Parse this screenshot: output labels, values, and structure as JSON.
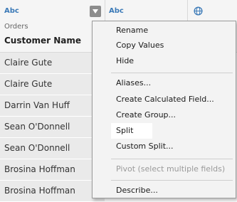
{
  "columns": [
    {
      "type_label": "Abc",
      "source": "Orders",
      "name": "Customer Name"
    },
    {
      "type_label": "Abc"
    },
    {
      "type_icon": "globe-icon"
    }
  ],
  "rows": [
    "Claire Gute",
    "Claire Gute",
    "Darrin Van Huff",
    "Sean O'Donnell",
    "Sean O'Donnell",
    "Brosina Hoffman",
    "Brosina Hoffman"
  ],
  "context_menu": {
    "items": [
      {
        "label": "Rename",
        "enabled": true
      },
      {
        "label": "Copy Values",
        "enabled": true
      },
      {
        "label": "Hide",
        "enabled": true
      },
      {
        "label": "Aliases...",
        "enabled": true
      },
      {
        "label": "Create Calculated Field...",
        "enabled": true
      },
      {
        "label": "Create Group...",
        "enabled": true
      },
      {
        "label": "Split",
        "enabled": true,
        "highlighted": true
      },
      {
        "label": "Custom Split...",
        "enabled": true
      },
      {
        "label": "Pivot (select multiple fields)",
        "enabled": false
      },
      {
        "label": "Describe...",
        "enabled": true
      }
    ]
  },
  "colors": {
    "type_label": "#3a79b7",
    "row_bg": "#eaeaea",
    "menu_bg": "#f3f3f3"
  }
}
